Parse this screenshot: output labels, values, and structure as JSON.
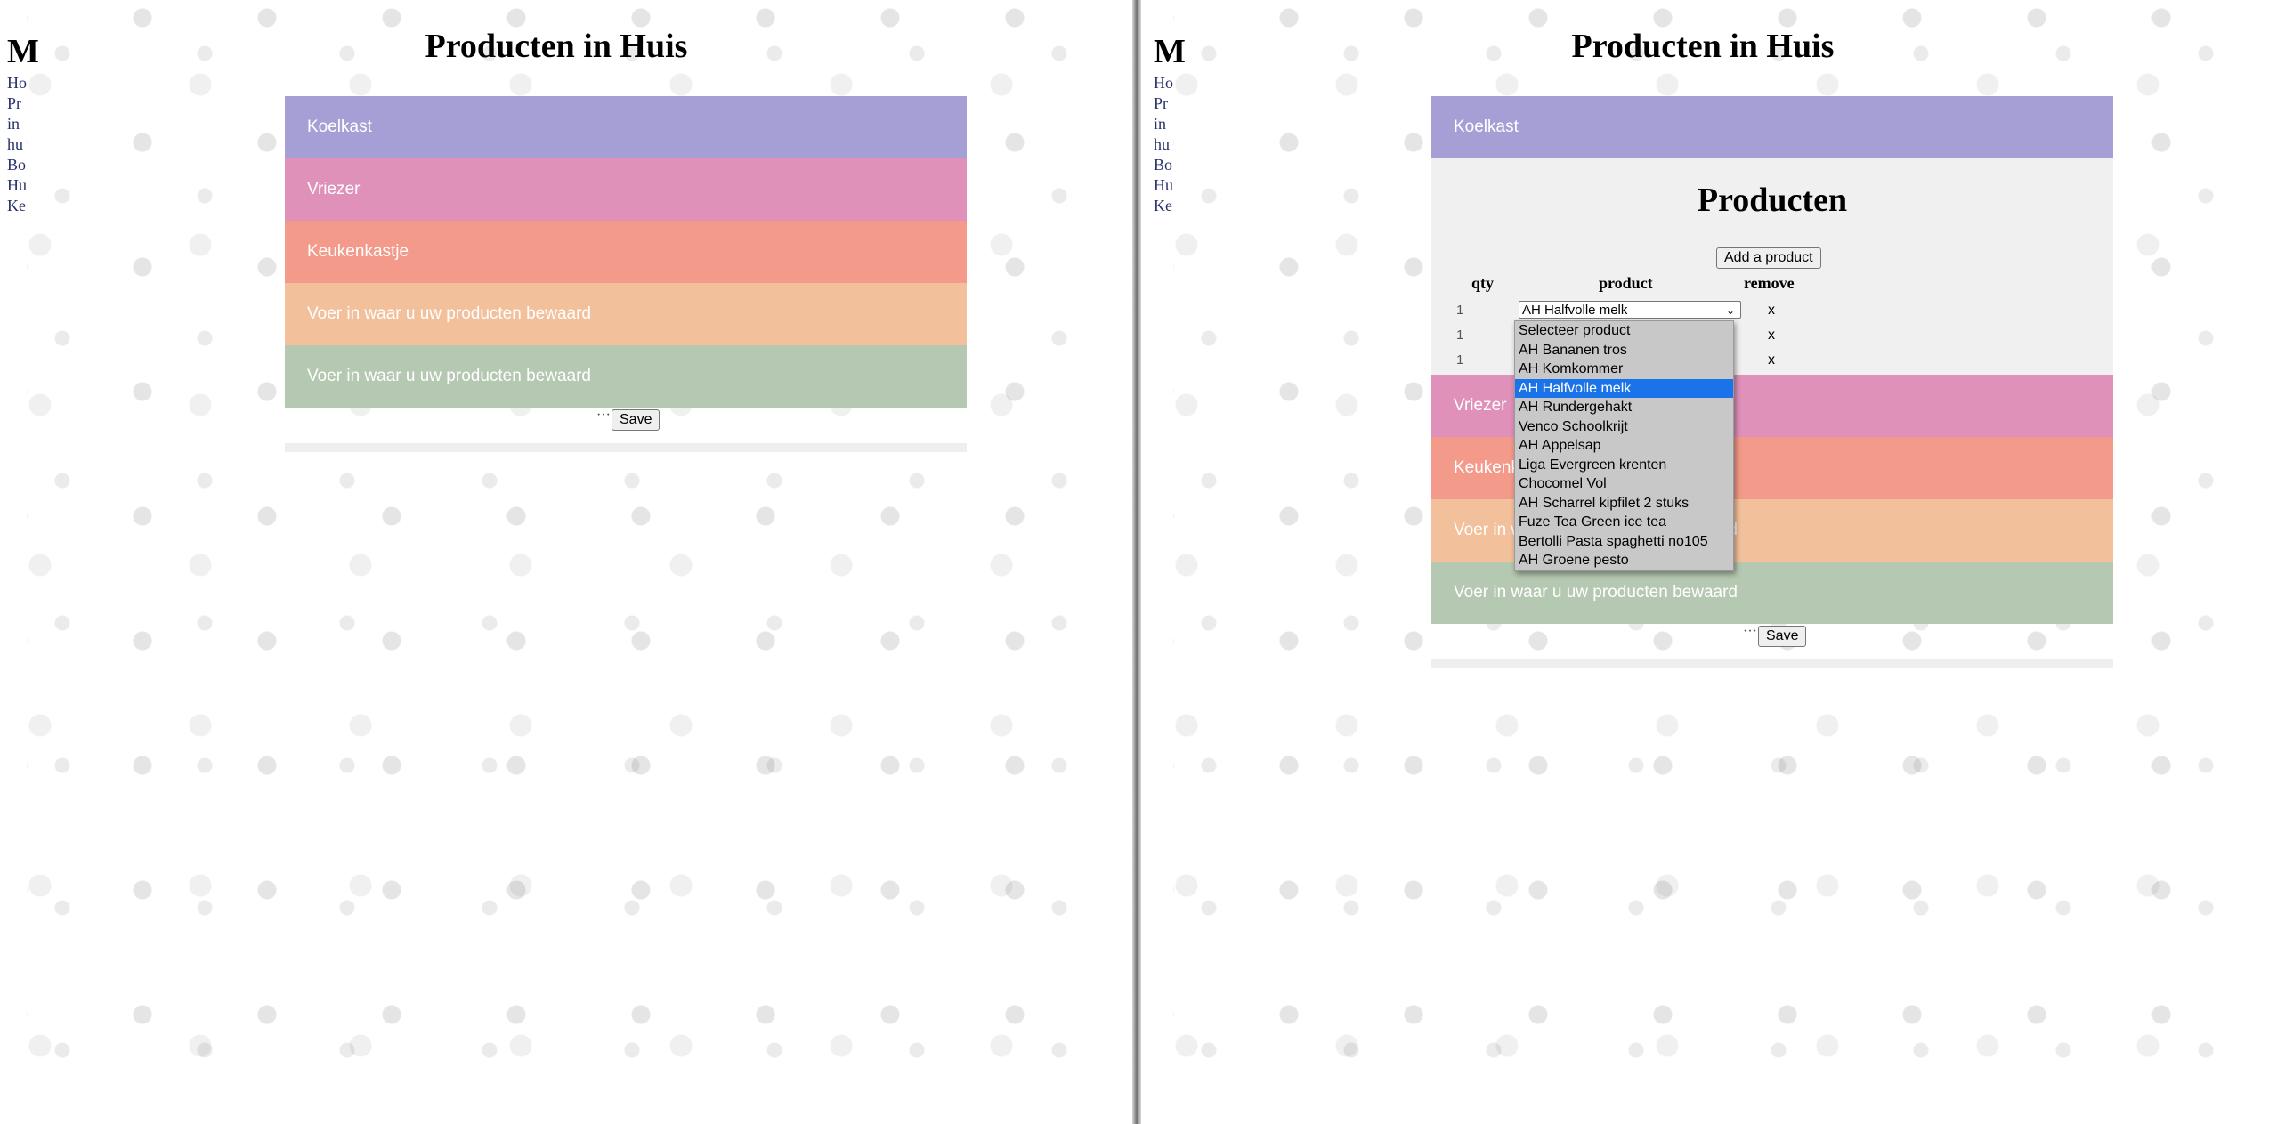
{
  "page_title": "Producten in Huis",
  "left_nav_fragments": {
    "big": "M",
    "lines": [
      "Ho",
      "Pr",
      "in",
      "hu",
      "Bo",
      "Hu",
      "Ke"
    ]
  },
  "storage_bars": [
    "Koelkast",
    "Vriezer",
    "Keukenkastje",
    "Voer in waar u uw producten bewaard",
    "Voer in waar u uw producten bewaard"
  ],
  "save_label": "Save",
  "save_ellipsis": "···",
  "products_section": {
    "heading": "Producten",
    "add_button": "Add a product",
    "columns": [
      "qty",
      "product",
      "remove"
    ],
    "rows": [
      {
        "qty": "1",
        "product": "AH Halfvolle melk",
        "remove": "x"
      },
      {
        "qty": "1",
        "remove": "x"
      },
      {
        "qty": "1",
        "remove": "x"
      }
    ]
  },
  "dropdown_options": [
    "Selecteer product",
    "AH Bananen tros",
    "AH Komkommer",
    "AH Halfvolle melk",
    "AH Rundergehakt",
    "Venco Schoolkrijt",
    "AH Appelsap",
    "Liga Evergreen krenten",
    "Chocomel Vol",
    "AH Scharrel kipfilet 2 stuks",
    "Fuze Tea Green ice tea",
    "Bertolli Pasta spaghetti no105",
    "AH Groene pesto"
  ],
  "dropdown_selected": "AH Halfvolle melk",
  "colors": {
    "koelkast": "#a69fd5",
    "vriezer": "#df91b9",
    "keukenkastje": "#f39a8a",
    "storage4": "#f2c19c",
    "storage5": "#b5c8b1",
    "selected_option": "#1a73e8"
  }
}
